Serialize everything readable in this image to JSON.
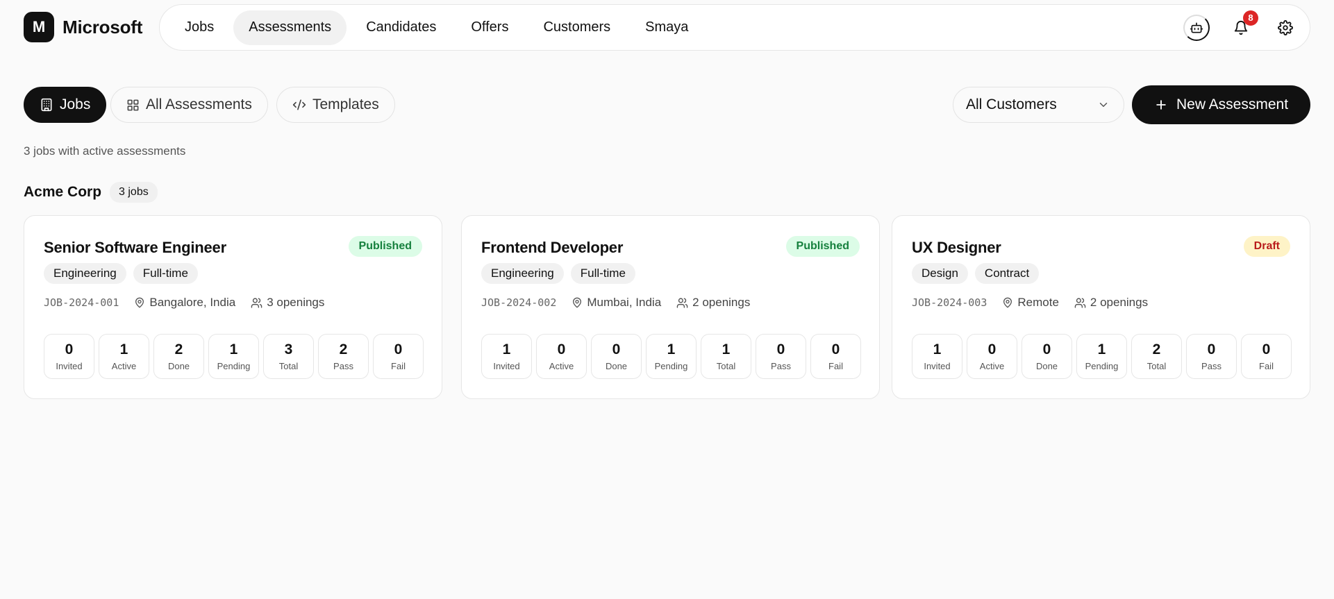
{
  "brand": {
    "logo_letter": "M",
    "name": "Microsoft"
  },
  "nav": {
    "items": [
      "Jobs",
      "Assessments",
      "Candidates",
      "Offers",
      "Customers",
      "Smaya"
    ],
    "active": "Assessments",
    "notifications_count": "8",
    "icons": [
      "bot-icon",
      "bell-icon",
      "gear-icon"
    ]
  },
  "toolbar": {
    "view_tabs": [
      {
        "label": "Jobs",
        "icon": "building-icon",
        "active": true
      },
      {
        "label": "All Assessments",
        "icon": "grid-icon",
        "active": false
      },
      {
        "label": "Templates",
        "icon": "code-icon",
        "active": false
      }
    ],
    "customer_filter": "All Customers",
    "new_button": "New Assessment"
  },
  "summary": "3 jobs with active assessments",
  "group": {
    "name": "Acme Corp",
    "count": "3 jobs"
  },
  "stat_labels": [
    "Invited",
    "Active",
    "Done",
    "Pending",
    "Total",
    "Pass",
    "Fail"
  ],
  "jobs": [
    {
      "title": "Senior Software Engineer",
      "status": "Published",
      "tags": [
        "Engineering",
        "Full-time"
      ],
      "job_id": "JOB-2024-001",
      "location": "Bangalore, India",
      "openings": "3 openings",
      "stats": [
        "0",
        "1",
        "2",
        "1",
        "3",
        "2",
        "0"
      ]
    },
    {
      "title": "Frontend Developer",
      "status": "Published",
      "tags": [
        "Engineering",
        "Full-time"
      ],
      "job_id": "JOB-2024-002",
      "location": "Mumbai, India",
      "openings": "2 openings",
      "stats": [
        "1",
        "0",
        "0",
        "1",
        "1",
        "0",
        "0"
      ]
    },
    {
      "title": "UX Designer",
      "status": "Draft",
      "tags": [
        "Design",
        "Contract"
      ],
      "job_id": "JOB-2024-003",
      "location": "Remote",
      "openings": "2 openings",
      "stats": [
        "1",
        "0",
        "0",
        "1",
        "2",
        "0",
        "0"
      ]
    }
  ],
  "colors": {
    "published_bg": "#dcfce7",
    "published_fg": "#15803d",
    "draft_bg": "#fef3c7",
    "draft_fg": "#b91c1c",
    "badge": "#dc2626",
    "primary": "#111111"
  }
}
